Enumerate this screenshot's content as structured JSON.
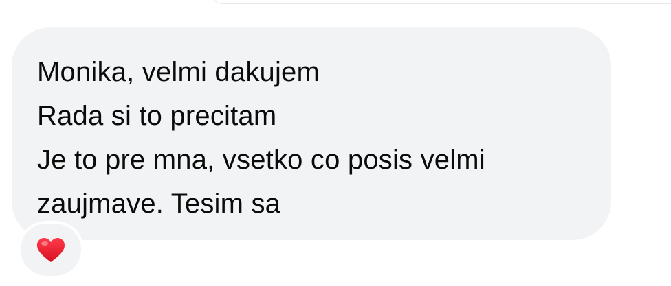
{
  "message": {
    "lines": [
      "Monika, velmi dakujem",
      "Rada si to precitam",
      "Je to pre mna, vsetko co posis velmi",
      "zaujmave. Tesim sa"
    ]
  },
  "reaction": {
    "icon": "red-heart-icon",
    "color": "#e8192c"
  },
  "colors": {
    "bubble": "#f2f3f5",
    "text": "#0b0b0b"
  }
}
